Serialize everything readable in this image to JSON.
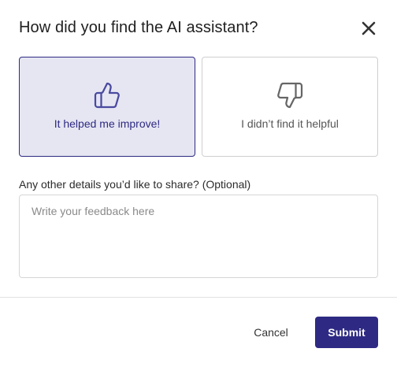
{
  "dialog": {
    "title": "How did you find the AI assistant?",
    "close_icon": "close-icon"
  },
  "options": [
    {
      "label": "It helped me improve!",
      "icon": "thumbs-up-icon",
      "selected": true
    },
    {
      "label": "I didn’t find it helpful",
      "icon": "thumbs-down-icon",
      "selected": false
    }
  ],
  "details": {
    "label": "Any other details you’d like to share? (Optional)",
    "placeholder": "Write your feedback here",
    "value": ""
  },
  "footer": {
    "cancel_label": "Cancel",
    "submit_label": "Submit"
  },
  "colors": {
    "accent": "#2e2a83",
    "selected_background": "#e6e6f2",
    "border": "#cfcfcf"
  }
}
